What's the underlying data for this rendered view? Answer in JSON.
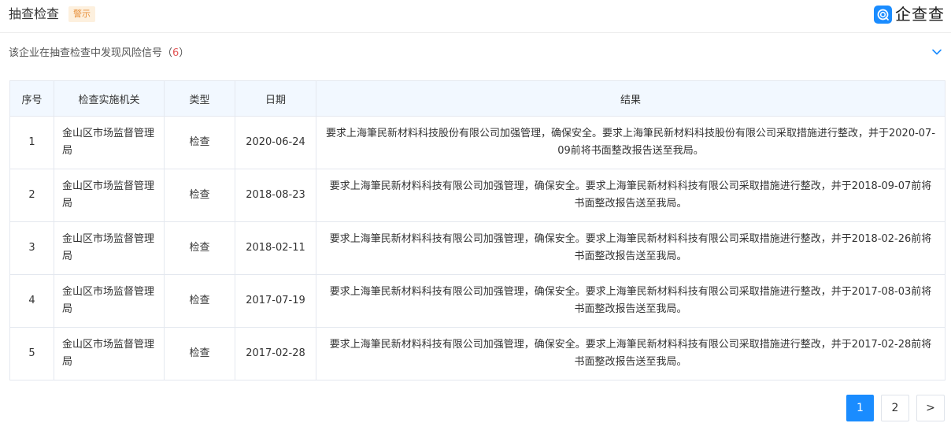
{
  "header": {
    "title": "抽查检查",
    "badge": "警示",
    "brand": "企查查"
  },
  "summary": {
    "text": "该企业在抽查检查中发现风险信号（",
    "count": "6",
    "close": "）"
  },
  "table": {
    "columns": [
      "序号",
      "检查实施机关",
      "类型",
      "日期",
      "结果"
    ],
    "rows": [
      {
        "no": "1",
        "org": "金山区市场监督管理局",
        "type": "检查",
        "date": "2020-06-24",
        "result": "要求上海筆民新材料科技股份有限公司加强管理，确保安全。要求上海筆民新材料科技股份有限公司采取措施进行整改，并于2020-07-09前将书面整改报告送至我局。"
      },
      {
        "no": "2",
        "org": "金山区市场监督管理局",
        "type": "检查",
        "date": "2018-08-23",
        "result": "要求上海筆民新材料科技有限公司加强管理，确保安全。要求上海筆民新材料科技有限公司采取措施进行整改，并于2018-09-07前将书面整改报告送至我局。"
      },
      {
        "no": "3",
        "org": "金山区市场监督管理局",
        "type": "检查",
        "date": "2018-02-11",
        "result": "要求上海筆民新材料科技有限公司加强管理，确保安全。要求上海筆民新材料科技有限公司采取措施进行整改，并于2018-02-26前将书面整改报告送至我局。"
      },
      {
        "no": "4",
        "org": "金山区市场监督管理局",
        "type": "检查",
        "date": "2017-07-19",
        "result": "要求上海筆民新材料科技有限公司加强管理，确保安全。要求上海筆民新材料科技有限公司采取措施进行整改，并于2017-08-03前将书面整改报告送至我局。"
      },
      {
        "no": "5",
        "org": "金山区市场监督管理局",
        "type": "检查",
        "date": "2017-02-28",
        "result": "要求上海筆民新材料科技有限公司加强管理，确保安全。要求上海筆民新材料科技有限公司采取措施进行整改，并于2017-02-28前将书面整改报告送至我局。"
      }
    ]
  },
  "pagination": {
    "pages": [
      "1",
      "2"
    ],
    "current": "1",
    "next": ">"
  },
  "colors": {
    "accent": "#1a8cff",
    "header_bg": "#f2f8ff",
    "badge_text": "#e8903a",
    "count_text": "#e35a5a"
  },
  "icons": {
    "brand": "qichacha-logo-icon",
    "collapse": "chevron-down-icon"
  }
}
